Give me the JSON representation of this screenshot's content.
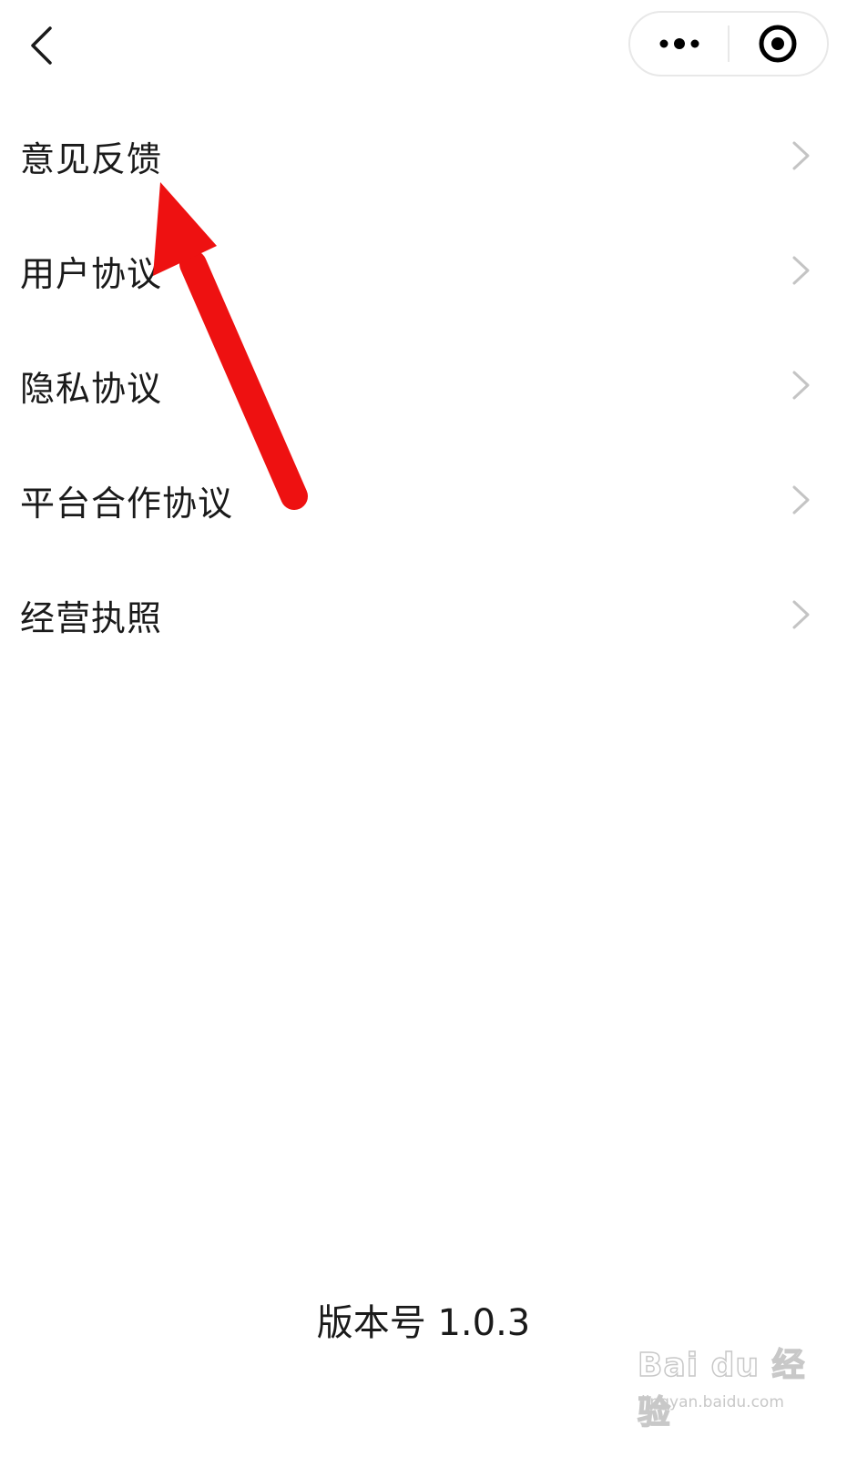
{
  "nav": {
    "back_icon": "chevron-left-icon",
    "more_icon": "more-dots-icon",
    "close_icon": "target-circle-icon"
  },
  "menu": {
    "items": [
      {
        "label": "意见反馈",
        "icon": "chevron-right-icon"
      },
      {
        "label": "用户协议",
        "icon": "chevron-right-icon"
      },
      {
        "label": "隐私协议",
        "icon": "chevron-right-icon"
      },
      {
        "label": "平台合作协议",
        "icon": "chevron-right-icon"
      },
      {
        "label": "经营执照",
        "icon": "chevron-right-icon"
      }
    ]
  },
  "footer": {
    "version": "版本号 1.0.3"
  },
  "overlay": {
    "arrow_color": "#ee1111"
  },
  "watermark": {
    "logo_text": "Bai du 经验",
    "url": "jingyan.baidu.com"
  },
  "colors": {
    "text": "#1a1a1a",
    "chevron": "#c4c4c4",
    "capsule_border": "#e8e8e8"
  }
}
